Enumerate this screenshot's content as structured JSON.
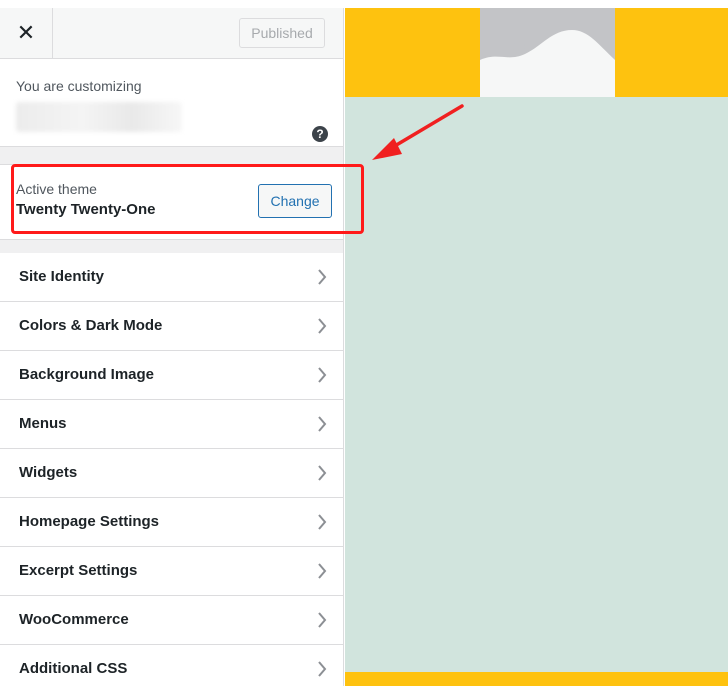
{
  "header": {
    "close_label": "✕",
    "publish_label": "Published"
  },
  "info": {
    "customizing_label": "You are customizing",
    "help_label": "?"
  },
  "theme": {
    "label": "Active theme",
    "name": "Twenty Twenty-One",
    "change_label": "Change"
  },
  "menu": {
    "items": [
      {
        "label": "Site Identity"
      },
      {
        "label": "Colors & Dark Mode"
      },
      {
        "label": "Background Image"
      },
      {
        "label": "Menus"
      },
      {
        "label": "Widgets"
      },
      {
        "label": "Homepage Settings"
      },
      {
        "label": "Excerpt Settings"
      },
      {
        "label": "WooCommerce"
      },
      {
        "label": "Additional CSS"
      }
    ]
  },
  "icons": {
    "close": "close-icon",
    "help": "help-icon",
    "chevron": "chevron-right-icon",
    "image_placeholder": "image-placeholder-icon"
  },
  "colors": {
    "accent": "#2271b1",
    "preview_bg": "#d1e4dd",
    "preview_header": "#fec20f",
    "highlight": "#ff1a1a"
  }
}
